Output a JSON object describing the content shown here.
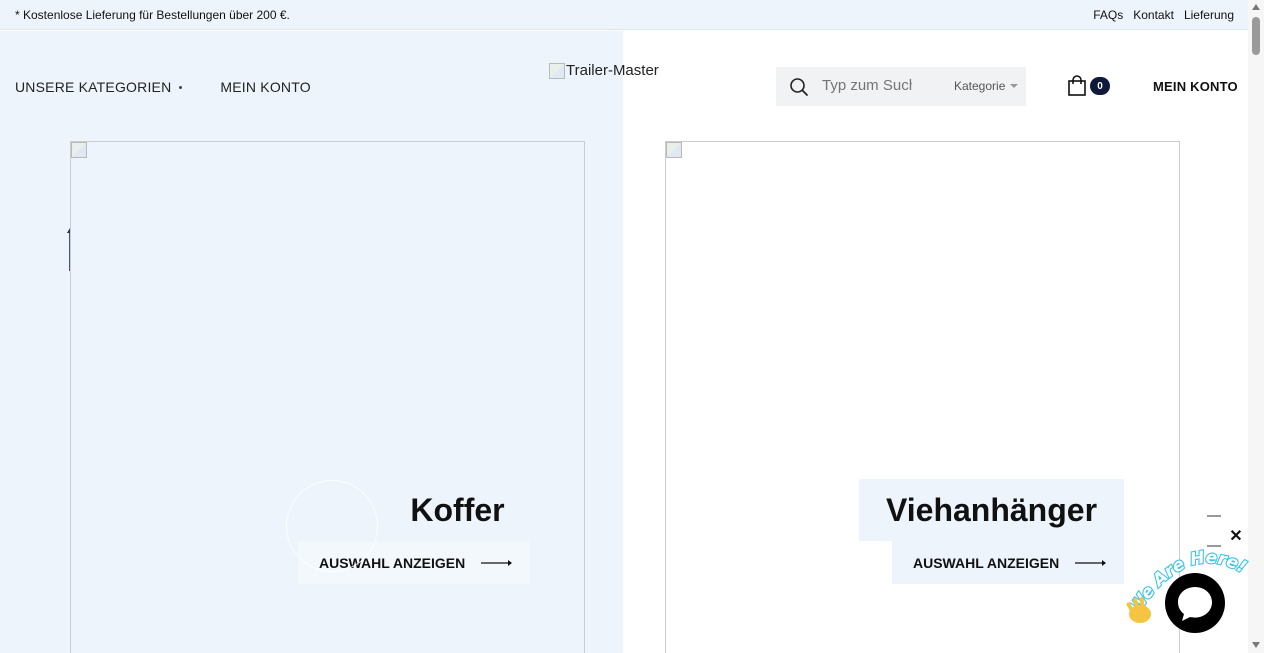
{
  "topbar": {
    "promo": "* Kostenlose Lieferung für Bestellungen über 200 €.",
    "links": [
      "FAQs",
      "Kontakt",
      "Lieferung"
    ]
  },
  "nav": {
    "categories_label": "UNSERE KATEGORIEN",
    "account_label": "MEIN KONTO"
  },
  "logo": {
    "alt": "Trailer-Master"
  },
  "search": {
    "placeholder": "Typ zum Suchen",
    "category_label": "Kategorie"
  },
  "cart": {
    "count": "0"
  },
  "account_right": "MEIN KONTO",
  "cards": [
    {
      "title": "Koffer",
      "cta": "AUSWAHL ANZEIGEN"
    },
    {
      "title": "Viehanhänger",
      "cta": "AUSWAHL ANZEIGEN"
    }
  ],
  "chat": {
    "badge_text": "We Are Here!"
  },
  "colors": {
    "pane_left_bg": "#edf4fc",
    "accent_dark": "#0e1a3a"
  }
}
